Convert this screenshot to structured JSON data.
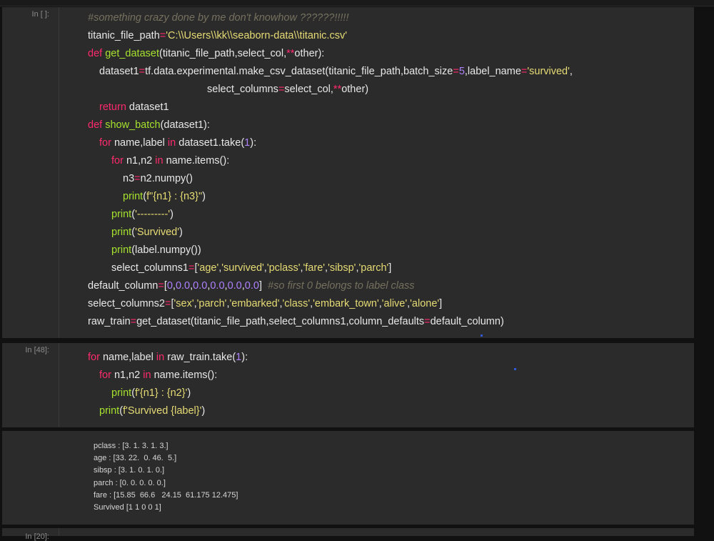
{
  "cells": [
    {
      "prompt": "In [ ]:",
      "lines": [
        {
          "i": 0,
          "t": [
            {
              "c": "cm",
              "s": "#something crazy done by me don't knowhow ??????!!!!!"
            }
          ]
        },
        {
          "i": 0,
          "t": [
            {
              "c": "",
              "s": "titanic_file_path"
            },
            {
              "c": "op",
              "s": "="
            },
            {
              "c": "str",
              "s": "'C:\\\\Users\\\\kk\\\\seaborn-data\\\\titanic.csv'"
            }
          ]
        },
        {
          "i": 0,
          "t": [
            {
              "c": "kw",
              "s": "def "
            },
            {
              "c": "fn",
              "s": "get_dataset"
            },
            {
              "c": "",
              "s": "(titanic_file_path,select_col,"
            },
            {
              "c": "op",
              "s": "**"
            },
            {
              "c": "",
              "s": "other):"
            }
          ]
        },
        {
          "i": 1,
          "t": [
            {
              "c": "",
              "s": "dataset1"
            },
            {
              "c": "op",
              "s": "="
            },
            {
              "c": "",
              "s": "tf.data.experimental.make_csv_dataset(titanic_file_path,batch_size"
            },
            {
              "c": "op",
              "s": "="
            },
            {
              "c": "num",
              "s": "5"
            },
            {
              "c": "",
              "s": ",label_name"
            },
            {
              "c": "op",
              "s": "="
            },
            {
              "c": "str",
              "s": "'survived'"
            },
            {
              "c": "",
              "s": ","
            }
          ]
        },
        {
          "i": 9,
          "t": [
            {
              "c": "",
              "s": "select_columns"
            },
            {
              "c": "op",
              "s": "="
            },
            {
              "c": "",
              "s": "select_col,"
            },
            {
              "c": "op",
              "s": "**"
            },
            {
              "c": "",
              "s": "other)"
            }
          ]
        },
        {
          "i": 1,
          "t": [
            {
              "c": "kw",
              "s": "return "
            },
            {
              "c": "",
              "s": "dataset1"
            }
          ]
        },
        {
          "i": 0,
          "t": [
            {
              "c": "kw",
              "s": "def "
            },
            {
              "c": "fn",
              "s": "show_batch"
            },
            {
              "c": "",
              "s": "(dataset1):"
            }
          ]
        },
        {
          "i": 1,
          "t": [
            {
              "c": "kw",
              "s": "for "
            },
            {
              "c": "",
              "s": "name,label "
            },
            {
              "c": "kw",
              "s": "in "
            },
            {
              "c": "",
              "s": "dataset1.take("
            },
            {
              "c": "num",
              "s": "1"
            },
            {
              "c": "",
              "s": "):"
            }
          ]
        },
        {
          "i": 2,
          "t": [
            {
              "c": "kw",
              "s": "for "
            },
            {
              "c": "",
              "s": "n1,n2 "
            },
            {
              "c": "kw",
              "s": "in "
            },
            {
              "c": "",
              "s": "name.items():"
            }
          ]
        },
        {
          "i": 3,
          "t": [
            {
              "c": "",
              "s": "n3"
            },
            {
              "c": "op",
              "s": "="
            },
            {
              "c": "",
              "s": "n2.numpy()"
            }
          ]
        },
        {
          "i": 3,
          "t": [
            {
              "c": "fn",
              "s": "print"
            },
            {
              "c": "",
              "s": "("
            },
            {
              "c": "str",
              "s": "f\"{n1} : {n3}\""
            },
            {
              "c": "",
              "s": ")"
            }
          ]
        },
        {
          "i": 2,
          "t": [
            {
              "c": "fn",
              "s": "print"
            },
            {
              "c": "",
              "s": "("
            },
            {
              "c": "str",
              "s": "'---------'"
            },
            {
              "c": "",
              "s": ")"
            }
          ]
        },
        {
          "i": 2,
          "t": [
            {
              "c": "fn",
              "s": "print"
            },
            {
              "c": "",
              "s": "("
            },
            {
              "c": "str",
              "s": "'Survived'"
            },
            {
              "c": "",
              "s": ")"
            }
          ]
        },
        {
          "i": 2,
          "t": [
            {
              "c": "fn",
              "s": "print"
            },
            {
              "c": "",
              "s": "(label.numpy())"
            }
          ]
        },
        {
          "i": 2,
          "t": [
            {
              "c": "",
              "s": "select_columns1"
            },
            {
              "c": "op",
              "s": "="
            },
            {
              "c": "",
              "s": "["
            },
            {
              "c": "str",
              "s": "'age'"
            },
            {
              "c": "",
              "s": ","
            },
            {
              "c": "str",
              "s": "'survived'"
            },
            {
              "c": "",
              "s": ","
            },
            {
              "c": "str",
              "s": "'pclass'"
            },
            {
              "c": "",
              "s": ","
            },
            {
              "c": "str",
              "s": "'fare'"
            },
            {
              "c": "",
              "s": ","
            },
            {
              "c": "str",
              "s": "'sibsp'"
            },
            {
              "c": "",
              "s": ","
            },
            {
              "c": "str",
              "s": "'parch'"
            },
            {
              "c": "",
              "s": "]"
            }
          ]
        },
        {
          "i": 0,
          "t": [
            {
              "c": "",
              "s": "default_column"
            },
            {
              "c": "op",
              "s": "="
            },
            {
              "c": "",
              "s": "["
            },
            {
              "c": "num",
              "s": "0"
            },
            {
              "c": "",
              "s": ","
            },
            {
              "c": "num",
              "s": "0.0"
            },
            {
              "c": "",
              "s": ","
            },
            {
              "c": "num",
              "s": "0.0"
            },
            {
              "c": "",
              "s": ","
            },
            {
              "c": "num",
              "s": "0.0"
            },
            {
              "c": "",
              "s": ","
            },
            {
              "c": "num",
              "s": "0.0"
            },
            {
              "c": "",
              "s": ","
            },
            {
              "c": "num",
              "s": "0.0"
            },
            {
              "c": "",
              "s": "]  "
            },
            {
              "c": "cm",
              "s": "#so first 0 belongs to label class"
            }
          ]
        },
        {
          "i": 0,
          "t": [
            {
              "c": "",
              "s": "select_columns2"
            },
            {
              "c": "op",
              "s": "="
            },
            {
              "c": "",
              "s": "["
            },
            {
              "c": "str",
              "s": "'sex'"
            },
            {
              "c": "",
              "s": ","
            },
            {
              "c": "str",
              "s": "'parch'"
            },
            {
              "c": "",
              "s": ","
            },
            {
              "c": "str",
              "s": "'embarked'"
            },
            {
              "c": "",
              "s": ","
            },
            {
              "c": "str",
              "s": "'class'"
            },
            {
              "c": "",
              "s": ","
            },
            {
              "c": "str",
              "s": "'embark_town'"
            },
            {
              "c": "",
              "s": ","
            },
            {
              "c": "str",
              "s": "'alive'"
            },
            {
              "c": "",
              "s": ","
            },
            {
              "c": "str",
              "s": "'alone'"
            },
            {
              "c": "",
              "s": "]"
            }
          ]
        },
        {
          "i": 0,
          "t": [
            {
              "c": "",
              "s": "raw_train"
            },
            {
              "c": "op",
              "s": "="
            },
            {
              "c": "",
              "s": "get_dataset(titanic_file_path,select_columns1,column_defaults"
            },
            {
              "c": "op",
              "s": "="
            },
            {
              "c": "",
              "s": "default_column)"
            }
          ]
        }
      ]
    },
    {
      "prompt": "In [48]:",
      "lines": [
        {
          "i": 0,
          "t": [
            {
              "c": "kw",
              "s": "for "
            },
            {
              "c": "",
              "s": "name,label "
            },
            {
              "c": "kw",
              "s": "in "
            },
            {
              "c": "",
              "s": "raw_train.take("
            },
            {
              "c": "num",
              "s": "1"
            },
            {
              "c": "",
              "s": "):"
            }
          ]
        },
        {
          "i": 1,
          "t": [
            {
              "c": "kw",
              "s": "for "
            },
            {
              "c": "",
              "s": "n1,n2 "
            },
            {
              "c": "kw",
              "s": "in "
            },
            {
              "c": "",
              "s": "name.items():"
            }
          ]
        },
        {
          "i": 2,
          "t": [
            {
              "c": "fn",
              "s": "print"
            },
            {
              "c": "",
              "s": "("
            },
            {
              "c": "str",
              "s": "f'{n1} : {n2}'"
            },
            {
              "c": "",
              "s": ")"
            }
          ]
        },
        {
          "i": 1,
          "t": [
            {
              "c": "fn",
              "s": "print"
            },
            {
              "c": "",
              "s": "("
            },
            {
              "c": "str",
              "s": "f'Survived {label}'"
            },
            {
              "c": "",
              "s": ")"
            }
          ]
        }
      ]
    }
  ],
  "output_lines": [
    "pclass : [3. 1. 3. 1. 3.]",
    "age : [33. 22.  0. 46.  5.]",
    "sibsp : [3. 1. 0. 1. 0.]",
    "parch : [0. 0. 0. 0. 0.]",
    "fare : [15.85  66.6   24.15  61.175 12.475]",
    "Survived [1 1 0 0 1]"
  ],
  "next_prompt": "In [20]:",
  "colors": {
    "keyword": "#ff2a6d",
    "function": "#a6e22e",
    "string": "#e6db74",
    "number": "#ae81ff",
    "comment": "#75715e"
  }
}
